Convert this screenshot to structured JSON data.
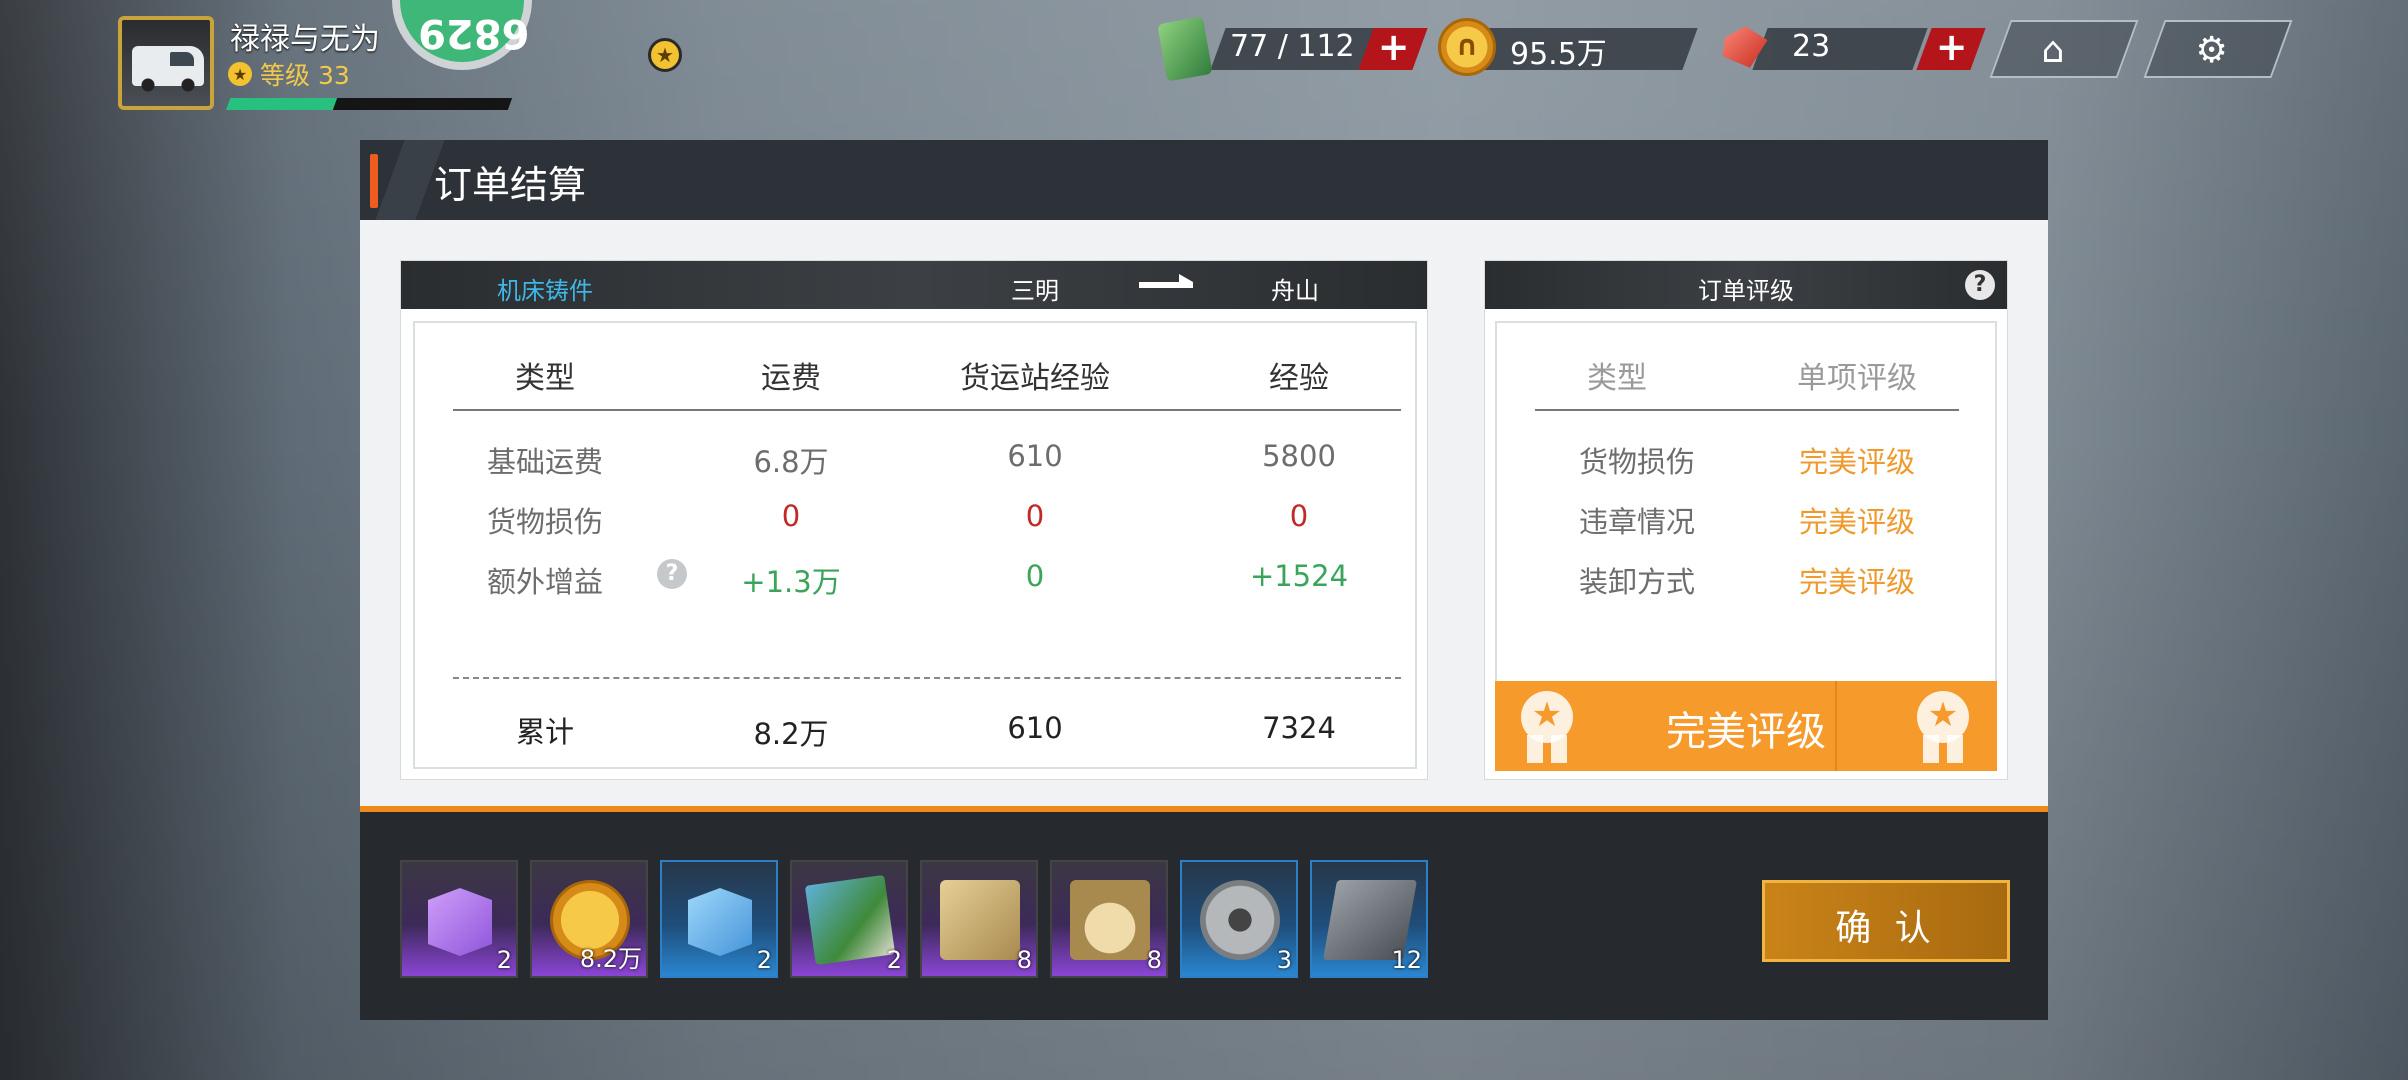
{
  "player": {
    "name": "禄禄与无为",
    "level_label": "等级 33",
    "xp_fraction": 0.38
  },
  "resources": {
    "fuel": "77 / 112",
    "coins": "95.5万",
    "gems": "23",
    "plus": "+"
  },
  "panel": {
    "title": "订单结算"
  },
  "order": {
    "cargo": "机床铸件",
    "from": "三明",
    "to": "舟山",
    "headers": [
      "类型",
      "运费",
      "货运站经验",
      "经验"
    ],
    "rows": [
      {
        "label": "基础运费",
        "fee": "6.8万",
        "station_exp": "610",
        "exp": "5800"
      },
      {
        "label": "货物损伤",
        "fee": "0",
        "station_exp": "0",
        "exp": "0"
      },
      {
        "label": "额外增益",
        "fee": "+1.3万",
        "station_exp": "0",
        "exp": "+1524"
      }
    ],
    "total": {
      "label": "累计",
      "fee": "8.2万",
      "station_exp": "610",
      "exp": "7324"
    }
  },
  "rating": {
    "title": "订单评级",
    "headers": [
      "类型",
      "单项评级"
    ],
    "rows": [
      {
        "label": "货物损伤",
        "value": "完美评级"
      },
      {
        "label": "违章情况",
        "value": "完美评级"
      },
      {
        "label": "装卸方式",
        "value": "完美评级"
      }
    ],
    "overall": "完美评级",
    "help": "?"
  },
  "rewards": [
    {
      "icon": "purple-box-icon",
      "count": "2"
    },
    {
      "icon": "coin-icon",
      "count": "8.2万"
    },
    {
      "icon": "blue-box-icon",
      "count": "2"
    },
    {
      "icon": "map-icon",
      "count": "2"
    },
    {
      "icon": "crate-icon",
      "count": "8"
    },
    {
      "icon": "gauge-icon",
      "count": "8"
    },
    {
      "icon": "gear-icon",
      "count": "3"
    },
    {
      "icon": "metal-sheet-icon",
      "count": "12"
    }
  ],
  "confirm_label": "确 认",
  "colors": {
    "accent_orange": "#ee8a1a",
    "rating_orange": "#f79a2c",
    "positive_green": "#3aa55a",
    "zero_red": "#c22828",
    "cargo_blue": "#3fb7e6"
  }
}
